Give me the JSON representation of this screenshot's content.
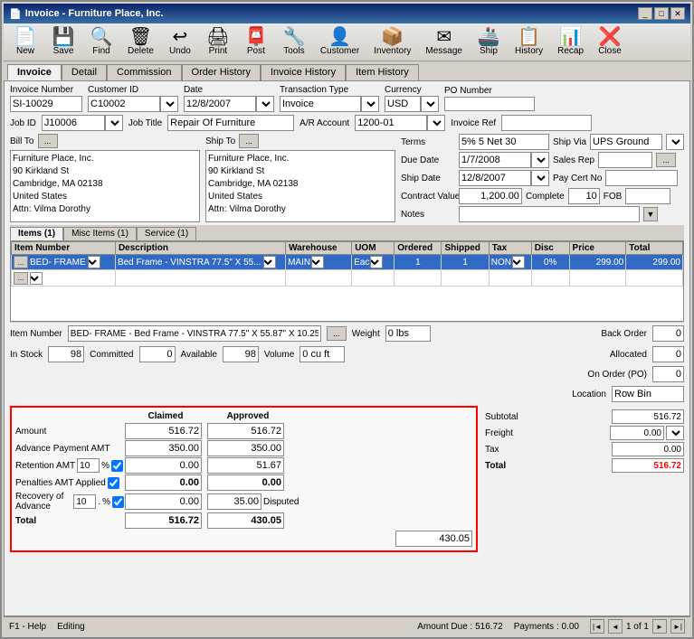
{
  "window": {
    "title": "Invoice - Furniture Place, Inc.",
    "icon": "📄"
  },
  "toolbar": {
    "buttons": [
      {
        "label": "New",
        "icon": "📄",
        "name": "new"
      },
      {
        "label": "Save",
        "icon": "💾",
        "name": "save"
      },
      {
        "label": "Find",
        "icon": "🔍",
        "name": "find"
      },
      {
        "label": "Delete",
        "icon": "🗑",
        "name": "delete"
      },
      {
        "label": "Undo",
        "icon": "↩",
        "name": "undo"
      },
      {
        "label": "Print",
        "icon": "🖨",
        "name": "print"
      },
      {
        "label": "Post",
        "icon": "📮",
        "name": "post"
      },
      {
        "label": "Tools",
        "icon": "🔧",
        "name": "tools"
      },
      {
        "label": "Customer",
        "icon": "👤",
        "name": "customer"
      },
      {
        "label": "Inventory",
        "icon": "📦",
        "name": "inventory"
      },
      {
        "label": "Message",
        "icon": "✉",
        "name": "message"
      },
      {
        "label": "Ship",
        "icon": "🚢",
        "name": "ship"
      },
      {
        "label": "History",
        "icon": "📋",
        "name": "history"
      },
      {
        "label": "Recap",
        "icon": "📊",
        "name": "recap"
      },
      {
        "label": "Close",
        "icon": "❌",
        "name": "close"
      }
    ]
  },
  "main_tabs": [
    "Invoice",
    "Detail",
    "Commission",
    "Order History",
    "Invoice History",
    "Item History"
  ],
  "active_main_tab": "Invoice",
  "invoice": {
    "invoice_number_label": "Invoice Number",
    "invoice_number": "SI-10029",
    "customer_id_label": "Customer ID",
    "customer_id": "C10002",
    "date_label": "Date",
    "date": "12/8/2007",
    "transaction_type_label": "Transaction Type",
    "transaction_type": "Invoice",
    "currency_label": "Currency",
    "currency": "USD",
    "po_number_label": "PO Number",
    "po_number": "",
    "job_id_label": "Job ID",
    "job_id": "J10006",
    "job_title_label": "Job Title",
    "job_title": "Repair Of Furniture",
    "ar_account_label": "A/R Account",
    "ar_account": "1200-01",
    "invoice_ref_label": "Invoice Ref",
    "invoice_ref": "",
    "bill_to_label": "Bill To",
    "bill_to_address": "Furniture Place, Inc.\n90 Kirkland St\nCambridge, MA 02138\nUnited States\nAttn: Vilma Dorothy",
    "ship_to_label": "Ship To",
    "ship_to_address": "Furniture Place, Inc.\n90 Kirkland St\nCambridge, MA 02138\nUnited States\nAttn: Vilma Dorothy",
    "terms_label": "Terms",
    "terms": "5% 5 Net 30",
    "ship_via_label": "Ship Via",
    "ship_via": "UPS Ground",
    "due_date_label": "Due Date",
    "due_date": "1/7/2008",
    "sales_rep_label": "Sales Rep",
    "sales_rep": "",
    "ship_date_label": "Ship Date",
    "ship_date": "12/8/2007",
    "pay_cert_no_label": "Pay Cert No",
    "pay_cert_no": "",
    "contract_value_label": "Contract Value",
    "contract_value": "1,200.00",
    "complete_label": "Complete",
    "complete": "10",
    "fob_label": "FOB",
    "fob": "",
    "notes_label": "Notes",
    "notes": ""
  },
  "items_tabs": [
    "Items (1)",
    "Misc Items (1)",
    "Service (1)"
  ],
  "active_items_tab": "Items (1)",
  "items_table": {
    "columns": [
      "Item Number",
      "Description",
      "Warehouse",
      "UOM",
      "Ordered",
      "Shipped",
      "Tax",
      "Disc",
      "Price",
      "Total"
    ],
    "rows": [
      {
        "item_number": "BED- FRAME",
        "description": "Bed Frame - VINSTRA 77.5\" X 55...",
        "warehouse": "MAIN",
        "uom": "Eac",
        "ordered": "1",
        "shipped": "1",
        "tax": "NON",
        "disc": "0%",
        "price": "299.00",
        "total": "299.00",
        "selected": true
      }
    ]
  },
  "item_detail": {
    "item_number_label": "Item Number",
    "item_number": "BED- FRAME - Bed Frame - VINSTRA 77.5\" X 55.87\" X 10.25\"",
    "weight_label": "Weight",
    "weight": "0 lbs",
    "back_order_label": "Back Order",
    "back_order": "0",
    "in_stock_label": "In Stock",
    "in_stock": "98",
    "committed_label": "Committed",
    "committed": "0",
    "available_label": "Available",
    "available": "98",
    "volume_label": "Volume",
    "volume": "0 cu ft",
    "allocated_label": "Allocated",
    "allocated": "0",
    "on_order_label": "On Order (PO)",
    "on_order": "0",
    "location_label": "Location",
    "location": "Row Bin"
  },
  "financials": {
    "claimed_label": "Claimed",
    "approved_label": "Approved",
    "amount_label": "Amount",
    "amount_claimed": "516.72",
    "amount_approved": "516.72",
    "advance_payment_label": "Advance Payment AMT",
    "advance_payment_claimed": "350.00",
    "advance_payment_approved": "350.00",
    "retention_label": "Retention AMT",
    "retention_pct": "10",
    "retention_claimed": "0.00",
    "retention_approved": "51.67",
    "penalties_label": "Penalties AMT",
    "penalties_applied": "Applied",
    "penalties_claimed": "0.00",
    "penalties_approved": "0.00",
    "recovery_label": "Recovery of Advance",
    "recovery_pct": "10",
    "recovery_claimed": "0.00",
    "recovery_approved": "35.00",
    "disputed_label": "Disputed",
    "disputed_value": "430.05",
    "total_label": "Total",
    "total_claimed": "516.72",
    "total_approved": "430.05",
    "subtotal_label": "Subtotal",
    "subtotal": "516.72",
    "freight_label": "Freight",
    "freight": "0.00",
    "tax_label": "Tax",
    "tax": "0.00",
    "grand_total_label": "Total",
    "grand_total": "516.72"
  },
  "status_bar": {
    "help": "F1 - Help",
    "editing": "Editing",
    "amount_due": "Amount Due : 516.72",
    "payments": "Payments : 0.00",
    "page": "1 of 1"
  }
}
